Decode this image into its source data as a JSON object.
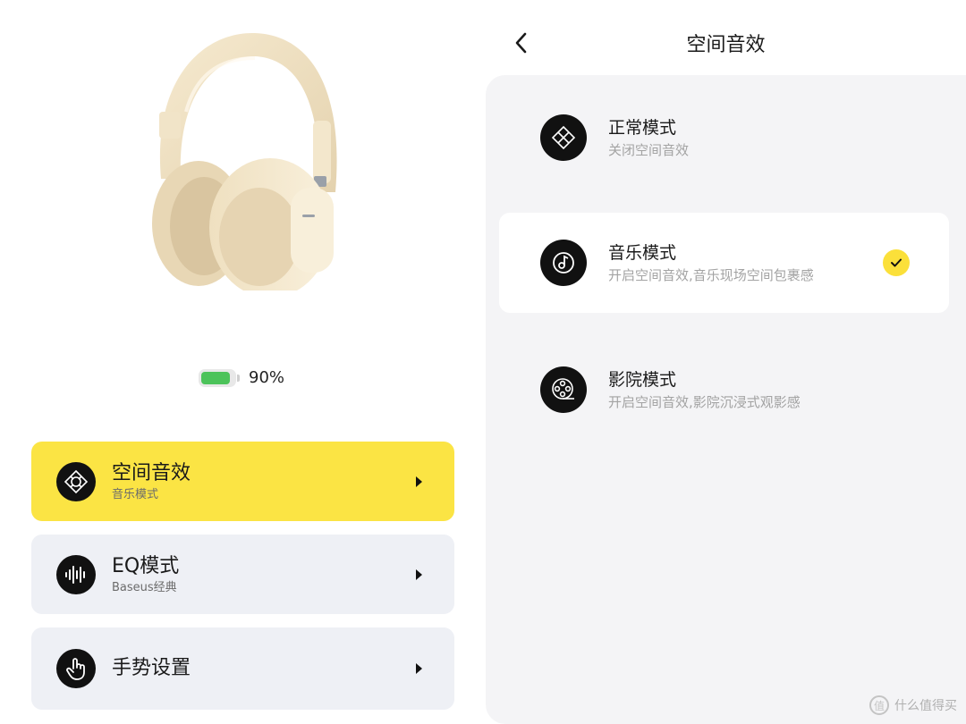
{
  "left": {
    "battery": {
      "level": 0.9,
      "label": "90%"
    },
    "menu": [
      {
        "title": "空间音效",
        "subtitle": "音乐模式",
        "icon": "spatial-audio-icon"
      },
      {
        "title": "EQ模式",
        "subtitle": "Baseus经典",
        "icon": "equalizer-wave-icon"
      },
      {
        "title": "手势设置",
        "subtitle": "",
        "icon": "hand-gesture-icon"
      }
    ]
  },
  "right": {
    "header": {
      "title": "空间音效"
    },
    "modes": [
      {
        "title": "正常模式",
        "subtitle": "关闭空间音效",
        "icon": "normal-mode-icon",
        "selected": false
      },
      {
        "title": "音乐模式",
        "subtitle": "开启空间音效,音乐现场空间包裹感",
        "icon": "music-mode-icon",
        "selected": true
      },
      {
        "title": "影院模式",
        "subtitle": "开启空间音效,影院沉浸式观影感",
        "icon": "film-reel-icon",
        "selected": false
      }
    ]
  },
  "watermark": {
    "text": "什么值得买"
  },
  "colors": {
    "accent": "#fbe444",
    "card": "#eef0f5",
    "battery": "#4cc35a",
    "panel": "#f4f4f6"
  }
}
